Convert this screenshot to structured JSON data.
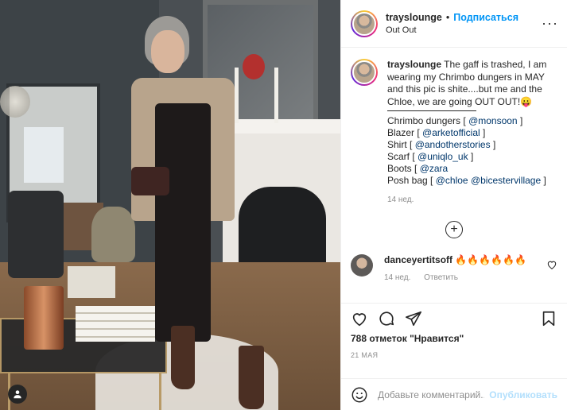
{
  "post": {
    "username": "trayslounge",
    "follow_label": "Подписаться",
    "location": "Out Out",
    "more_icon": "more-horizontal-icon"
  },
  "caption": {
    "username": "trayslounge",
    "text": "The gaff is trashed, I am wearing my Chrimbo dungers in MAY and this pic is shite....but me and the Chloe, we are going OUT OUT!😛",
    "credits": [
      {
        "item": "Chrimbo dungers [",
        "tags": [
          "@monsoon"
        ],
        "end": "]"
      },
      {
        "item": "Blazer [",
        "tags": [
          "@arketofficial"
        ],
        "end": "]"
      },
      {
        "item": "Shirt [",
        "tags": [
          "@andotherstories"
        ],
        "end": "]"
      },
      {
        "item": "Scarf [",
        "tags": [
          "@uniqlo_uk"
        ],
        "end": "]"
      },
      {
        "item": "Boots [",
        "tags": [
          "@zara"
        ],
        "end": ""
      },
      {
        "item": "Posh bag [",
        "tags": [
          "@chloe",
          "@bicestervillage"
        ],
        "end": "]"
      }
    ],
    "time": "14 нед."
  },
  "load_more_icon": "plus-circle-icon",
  "comment": {
    "username": "danceyertitsoff",
    "text": "🔥🔥🔥🔥🔥🔥",
    "time": "14 нед.",
    "reply_label": "Ответить"
  },
  "actions": {
    "likes_count": "788",
    "likes_text": "отметок \"Нравится\"",
    "date": "21 МАЯ"
  },
  "add_comment": {
    "placeholder": "Добавьте комментарий...",
    "publish_label": "Опубликовать"
  },
  "colors": {
    "accent": "#0095f6",
    "publish_disabled": "#b2dffc",
    "link": "#00376b",
    "muted": "#8e8e8e"
  }
}
